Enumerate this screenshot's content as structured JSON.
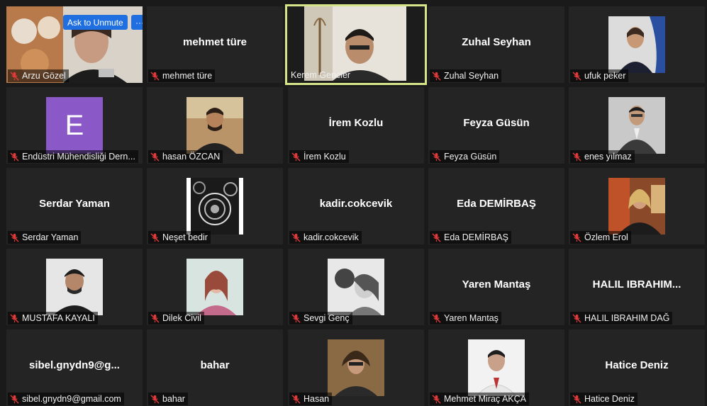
{
  "overlay": {
    "unmute_label": "Ask to Unmute",
    "more_label": "···"
  },
  "tiles": [
    {
      "name": "Arzu Gözel",
      "show_center": false
    },
    {
      "name": "mehmet türe",
      "center": "mehmet türe"
    },
    {
      "name": "Kerem Gencler",
      "active": true
    },
    {
      "name": "Zuhal Seyhan",
      "center": "Zuhal Seyhan"
    },
    {
      "name": "ufuk peker"
    },
    {
      "name": "Endüstri Mühendisliği Dern...",
      "avatar_letter": "E"
    },
    {
      "name": "hasan ÖZCAN"
    },
    {
      "name": "İrem Kozlu",
      "center": "İrem Kozlu"
    },
    {
      "name": "Feyza Güsün",
      "center": "Feyza Güsün"
    },
    {
      "name": "enes yılmaz"
    },
    {
      "name": "Serdar Yaman",
      "center": "Serdar Yaman"
    },
    {
      "name": "Neşet bedir"
    },
    {
      "name": "kadir.cokcevik",
      "center": "kadir.cokcevik"
    },
    {
      "name": "Eda DEMİRBAŞ",
      "center": "Eda DEMİRBAŞ"
    },
    {
      "name": "Özlem Erol"
    },
    {
      "name": "MUSTAFA KAYALI"
    },
    {
      "name": "Dilek Civil"
    },
    {
      "name": "Sevgi Genç"
    },
    {
      "name": "Yaren Mantaş",
      "center": "Yaren Mantaş"
    },
    {
      "name": "HALIL IBRAHIM DAĞ",
      "center": "HALIL IBRAHIM..."
    },
    {
      "name": "sibel.gnydn9@gmail.com",
      "center": "sibel.gnydn9@g..."
    },
    {
      "name": "bahar",
      "center": "bahar"
    },
    {
      "name": "Hasan"
    },
    {
      "name": "Mehmet Miraç AKÇA"
    },
    {
      "name": "Hatice Deniz",
      "center": "Hatice Deniz"
    }
  ],
  "colors": {
    "active_border": "#d6e58a",
    "mute_red": "#e03a3a",
    "tile_bg": "#242424"
  }
}
